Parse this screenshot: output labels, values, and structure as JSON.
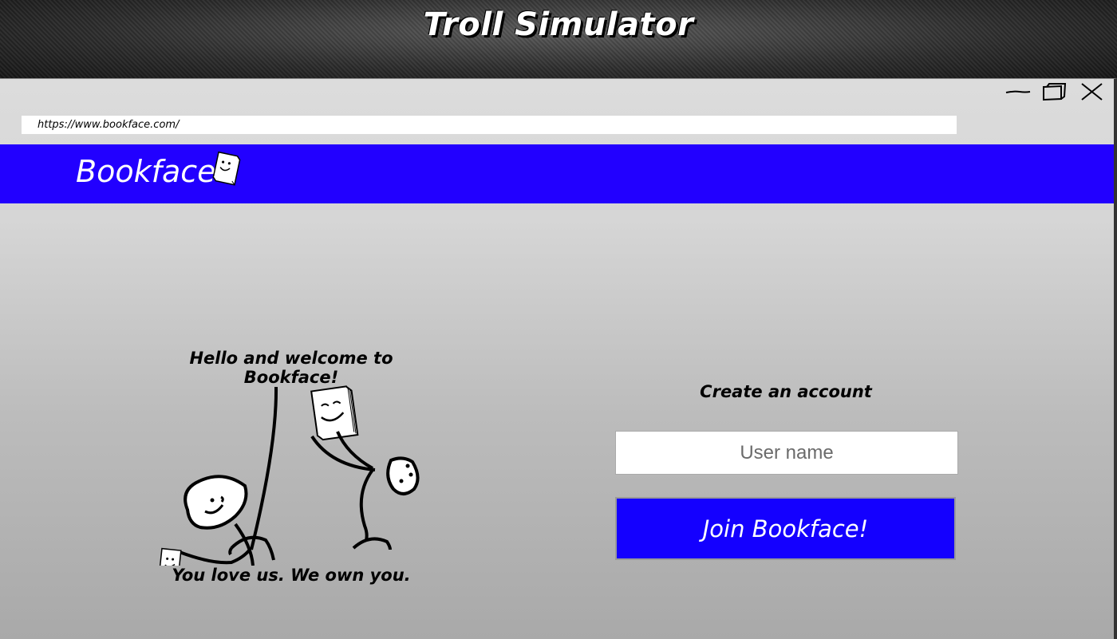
{
  "game": {
    "title": "Troll Simulator"
  },
  "browser": {
    "url": "https://www.bookface.com/",
    "controls": {
      "minimize_icon": "minimize-icon",
      "maximize_icon": "maximize-icon",
      "close_icon": "close-icon"
    }
  },
  "site": {
    "name": "Bookface",
    "logo_icon": "book-face-icon",
    "brand_color": "#2200ff"
  },
  "welcome": {
    "heading": "Hello and welcome to Bookface!",
    "tagline": "You love us. We own you."
  },
  "signup": {
    "heading": "Create an account",
    "username_placeholder": "User name",
    "join_label": "Join Bookface!",
    "button_color": "#1400ff"
  }
}
